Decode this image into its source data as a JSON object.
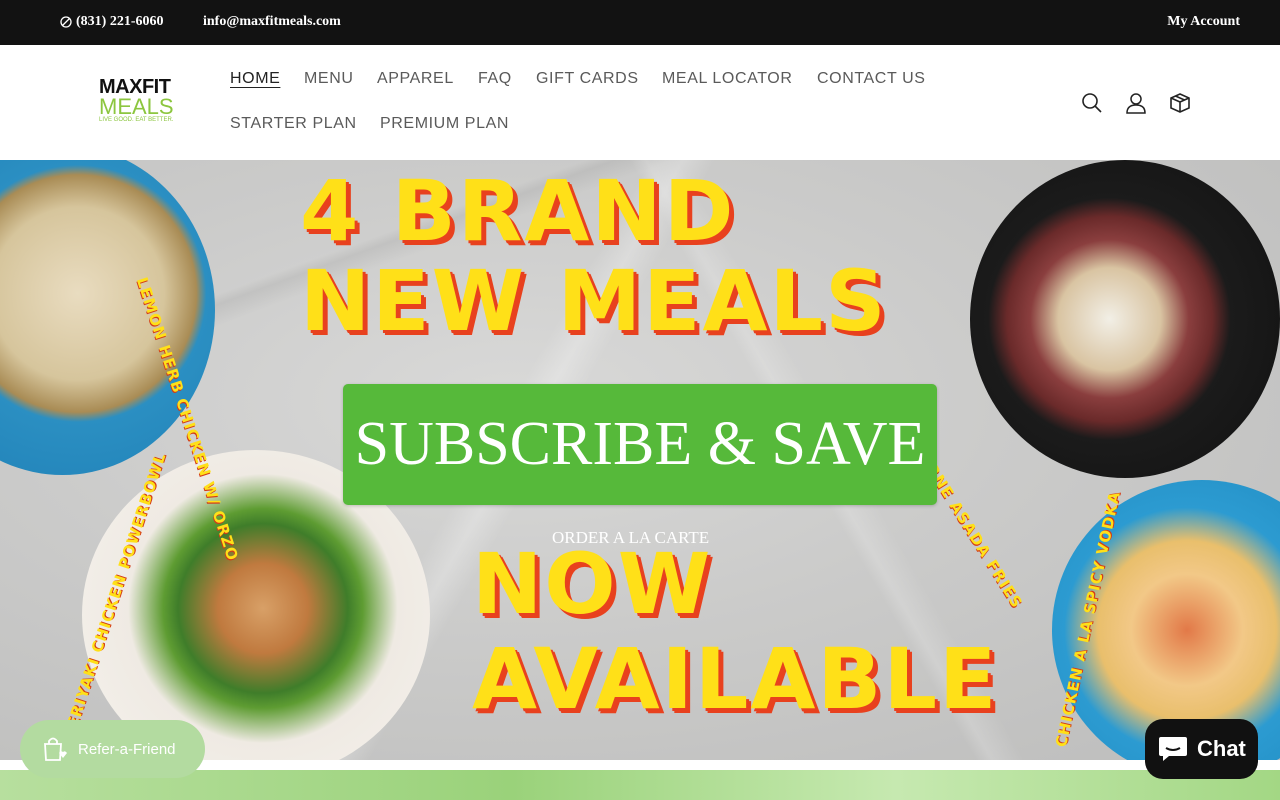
{
  "topbar": {
    "phone": "(831) 221-6060",
    "email": "info@maxfitmeals.com",
    "account": "My Account"
  },
  "logo": {
    "line1": "MAXFIT",
    "line2": "MEALS",
    "tagline": "LIVE GOOD. EAT BETTER."
  },
  "nav": {
    "items": [
      {
        "label": "HOME",
        "active": true
      },
      {
        "label": "MENU"
      },
      {
        "label": "APPAREL"
      },
      {
        "label": "FAQ"
      },
      {
        "label": "GIFT CARDS"
      },
      {
        "label": "MEAL LOCATOR"
      },
      {
        "label": "CONTACT US"
      },
      {
        "label": "STARTER PLAN"
      },
      {
        "label": "PREMIUM PLAN"
      }
    ]
  },
  "header_icons": [
    "search-icon",
    "account-icon",
    "cart-icon"
  ],
  "hero": {
    "headline_line1": "4 BRAND",
    "headline_line2": "NEW MEALS",
    "subscribe_label": "SUBSCRIBE & SAVE",
    "alacarte_label": "ORDER A LA CARTE",
    "now_line1": "NOW",
    "now_line2": "AVAILABLE",
    "meal_1": "LEMON HERB CHICKEN W/ ORZO",
    "meal_2": "CARNE ASADA FRIES",
    "meal_3": "TERIYAKI CHICKEN POWERBOWL",
    "meal_4": "CHICKEN A LA SPICY VODKA"
  },
  "widgets": {
    "refer_label": "Refer-a-Friend",
    "chat_label": "Chat"
  },
  "colors": {
    "brand_green": "#8cc63f",
    "subscribe_green": "#56b93a",
    "headline_yellow": "#ffe018",
    "headline_shadow": "#e8411e"
  }
}
